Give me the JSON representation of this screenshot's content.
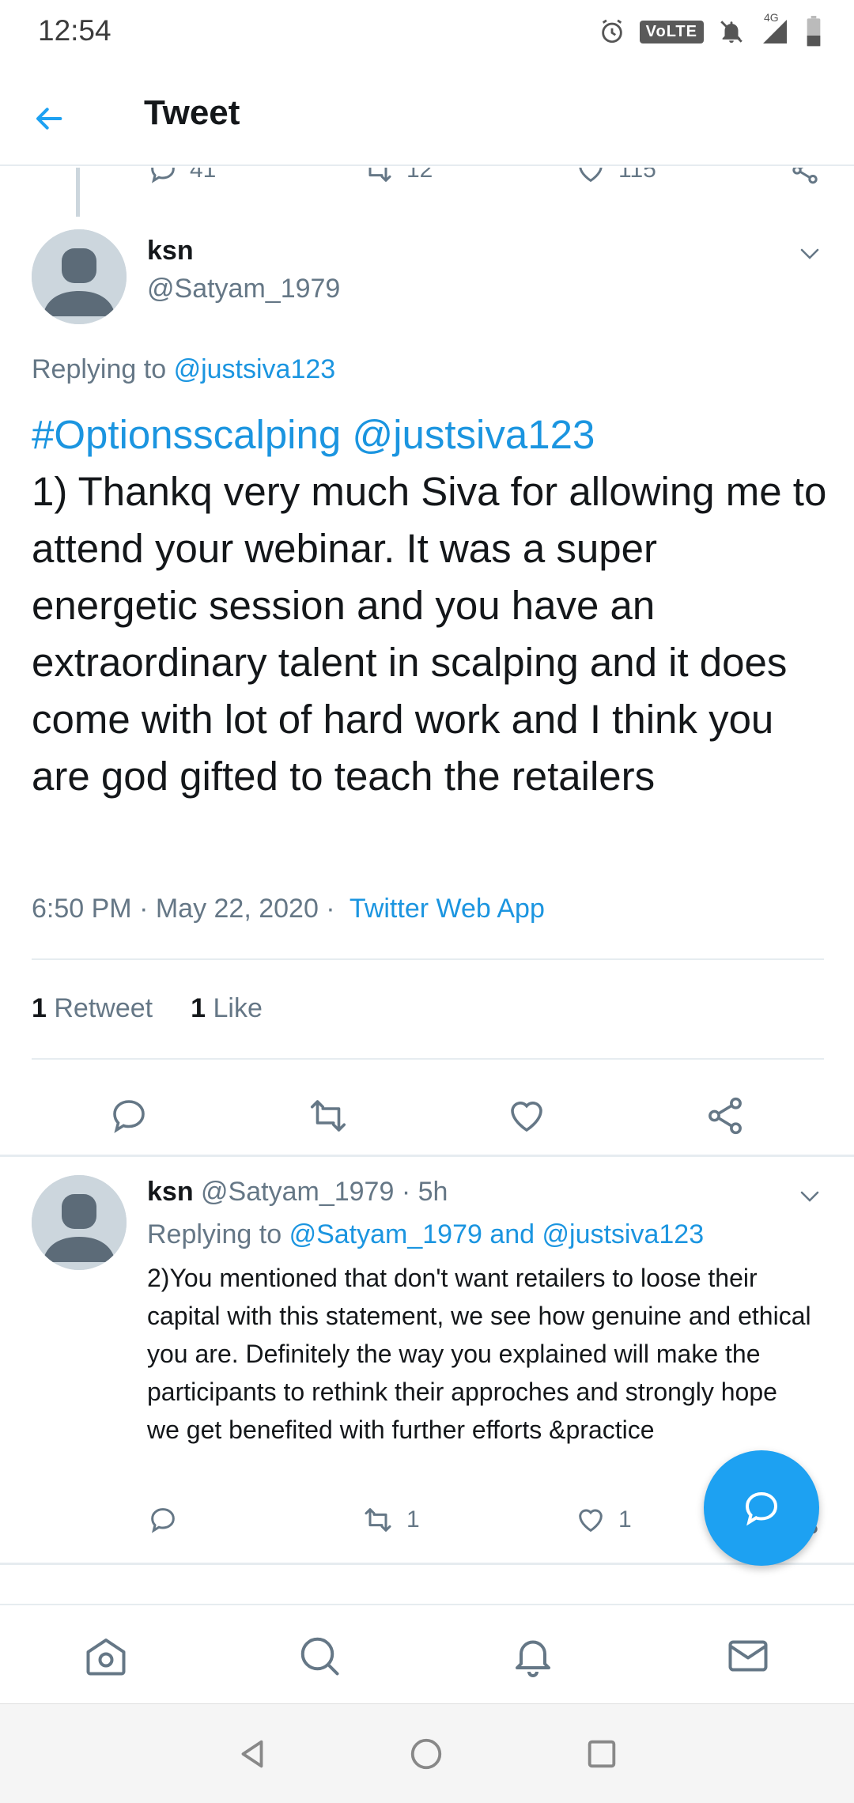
{
  "status_bar": {
    "time": "12:54",
    "volte": "VoLTE",
    "network": "4G"
  },
  "header": {
    "title": "Tweet"
  },
  "prev_tweet_actions": {
    "replies": "41",
    "retweets": "12",
    "likes": "115"
  },
  "tweet": {
    "name": "ksn",
    "handle": "@Satyam_1979",
    "replying_prefix": "Replying to",
    "replying_to": "@justsiva123",
    "hashtag": "#Optionsscalping",
    "mention": "@justsiva123",
    "body": "1) Thankq very much Siva for allowing me to attend your webinar. It was a super energetic session and you have an extraordinary talent in scalping and it does come with lot of hard work and I think you are god gifted to teach the retailers",
    "timestamp": "6:50 PM · May 22, 2020 · ",
    "source": "Twitter Web App",
    "retweet_count": "1",
    "retweet_label": "Retweet",
    "like_count": "1",
    "like_label": "Like"
  },
  "reply": {
    "name": "ksn",
    "handle": "@Satyam_1979",
    "time": "· 5h",
    "replying_prefix": "Replying to",
    "replying_to": "@Satyam_1979 and @justsiva123",
    "body": "2)You mentioned that don't want retailers to loose their capital with this statement, we see how genuine and ethical you are. Definitely the way you explained will make the participants to rethink their approches and strongly hope we get benefited with further efforts &practice",
    "retweets": "1",
    "likes": "1"
  },
  "colors": {
    "accent": "#1da1f2",
    "link": "#1b95e0",
    "secondary_text": "#657786",
    "divider": "#e6ecf0"
  },
  "icons": [
    "back-arrow-icon",
    "reply-icon",
    "retweet-icon",
    "like-icon",
    "share-icon",
    "chevron-down-icon",
    "home-icon",
    "search-icon",
    "notifications-icon",
    "messages-icon",
    "compose-reply-icon"
  ]
}
